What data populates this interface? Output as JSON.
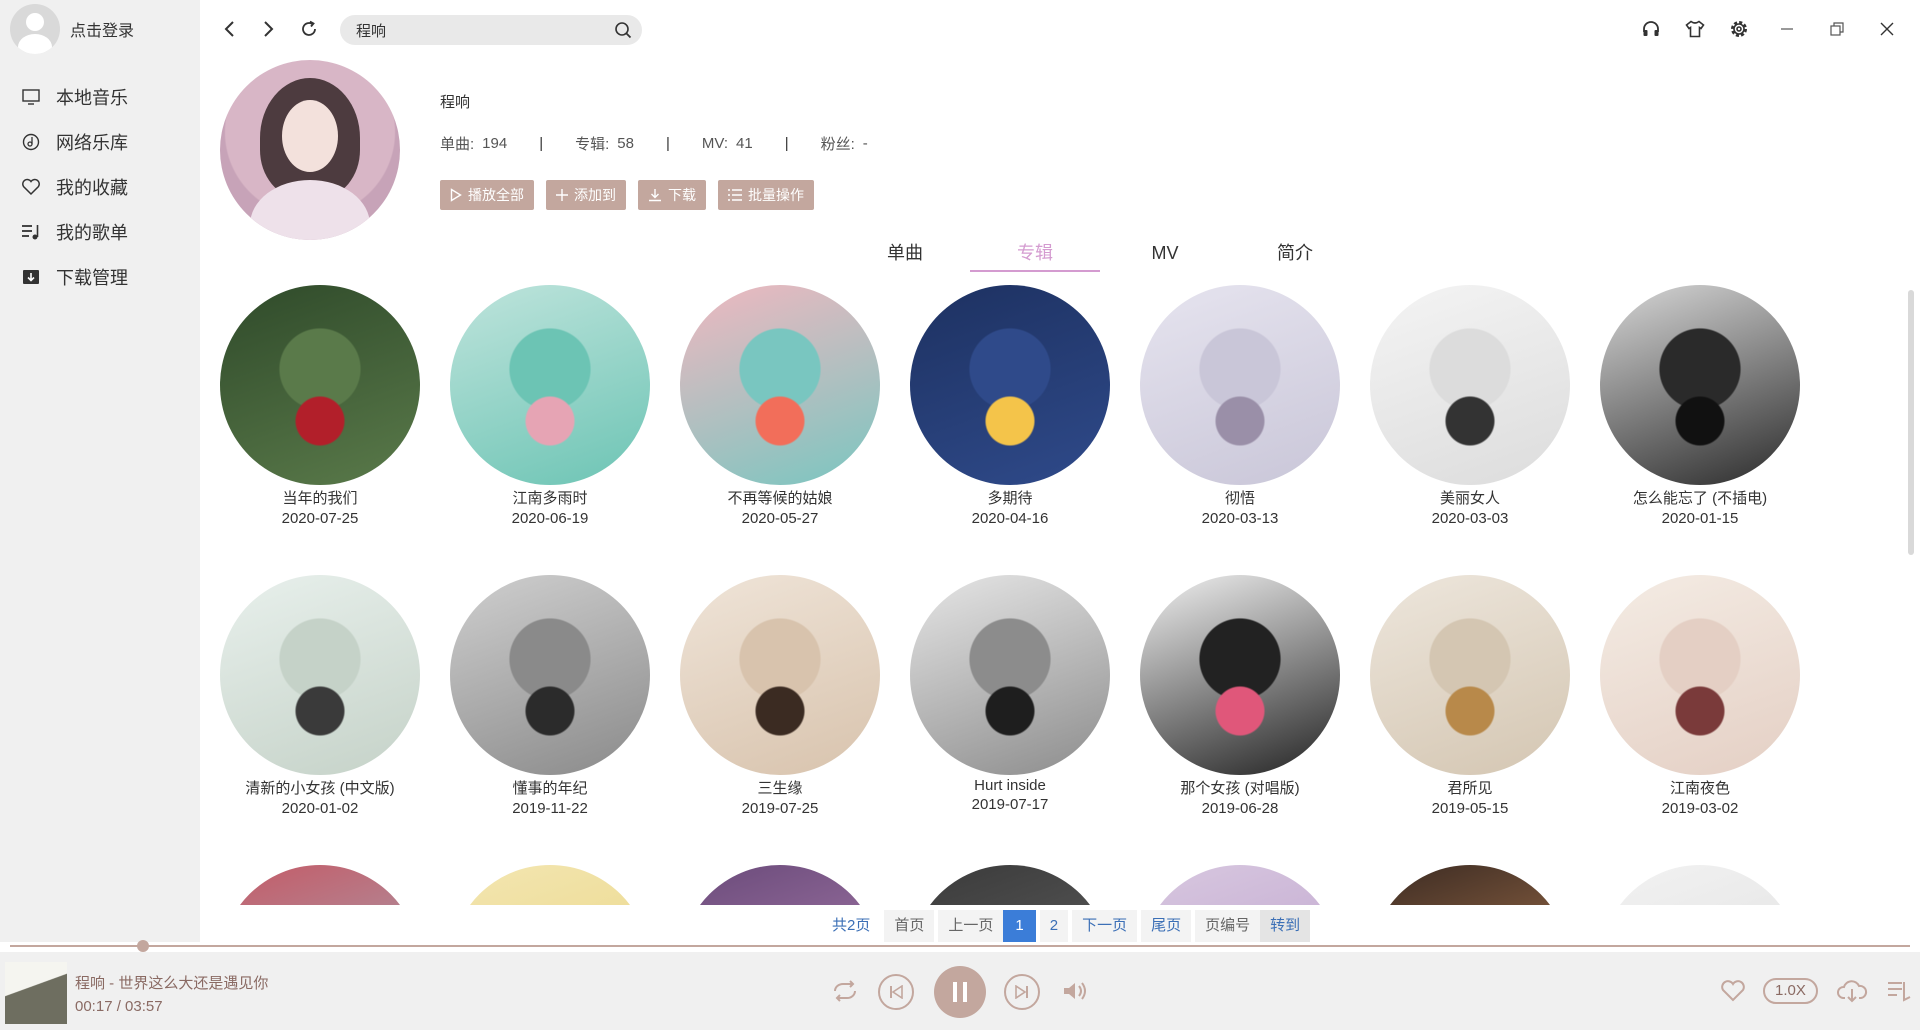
{
  "sidebar": {
    "login_label": "点击登录",
    "items": [
      {
        "label": "本地音乐",
        "icon": "monitor-icon"
      },
      {
        "label": "网络乐库",
        "icon": "music-disc-icon"
      },
      {
        "label": "我的收藏",
        "icon": "heart-icon"
      },
      {
        "label": "我的歌单",
        "icon": "playlist-icon"
      },
      {
        "label": "下载管理",
        "icon": "download-folder-icon"
      }
    ]
  },
  "search": {
    "value": "程响"
  },
  "artist": {
    "name": "程响",
    "stats": [
      {
        "label": "单曲:",
        "value": "194"
      },
      {
        "label": "专辑:",
        "value": "58"
      },
      {
        "label": "MV:",
        "value": "41"
      },
      {
        "label": "粉丝:",
        "value": "-"
      }
    ]
  },
  "actions": [
    {
      "label": "播放全部",
      "icon": "play-icon"
    },
    {
      "label": "添加到",
      "icon": "plus-icon"
    },
    {
      "label": "下载",
      "icon": "download-icon"
    },
    {
      "label": "批量操作",
      "icon": "list-icon"
    }
  ],
  "tabs": [
    {
      "label": "单曲",
      "active": false
    },
    {
      "label": "专辑",
      "active": true
    },
    {
      "label": "MV",
      "active": false
    },
    {
      "label": "简介",
      "active": false
    }
  ],
  "albums": [
    {
      "title": "当年的我们",
      "date": "2020-07-25",
      "colors": [
        "#2f4a2a",
        "#5a7a4a",
        "#b21f2a"
      ]
    },
    {
      "title": "江南多雨时",
      "date": "2020-06-19",
      "colors": [
        "#bfe4dc",
        "#6cc4b4",
        "#e6a4b4"
      ]
    },
    {
      "title": "不再等候的姑娘",
      "date": "2020-05-27",
      "colors": [
        "#f0b8c0",
        "#79c6c0",
        "#f26e5a"
      ]
    },
    {
      "title": "多期待",
      "date": "2020-04-16",
      "colors": [
        "#1d3161",
        "#2f4a8a",
        "#f4c44a"
      ]
    },
    {
      "title": "彻悟",
      "date": "2020-03-13",
      "colors": [
        "#e6e4ef",
        "#c9c6d8",
        "#9a8fa8"
      ]
    },
    {
      "title": "美丽女人",
      "date": "2020-03-03",
      "colors": [
        "#f4f4f4",
        "#dcdcdc",
        "#333333"
      ]
    },
    {
      "title": "怎么能忘了 (不插电)",
      "date": "2020-01-15",
      "colors": [
        "#d8d8d8",
        "#2a2a2a",
        "#111111"
      ]
    },
    {
      "title": "清新的小女孩 (中文版)",
      "date": "2020-01-02",
      "colors": [
        "#e8f0ec",
        "#c5d2c8",
        "#3a3a3a"
      ]
    },
    {
      "title": "懂事的年纪",
      "date": "2019-11-22",
      "colors": [
        "#cfcfcf",
        "#8a8a8a",
        "#2b2b2b"
      ]
    },
    {
      "title": "三生缘",
      "date": "2019-07-25",
      "colors": [
        "#efe4d8",
        "#d8c3ad",
        "#3b2b22"
      ]
    },
    {
      "title": "Hurt inside",
      "date": "2019-07-17",
      "colors": [
        "#e6e6e6",
        "#8c8c8c",
        "#1e1e1e"
      ]
    },
    {
      "title": "那个女孩 (对唱版)",
      "date": "2019-06-28",
      "colors": [
        "#f2f2f2",
        "#222222",
        "#e0577a"
      ]
    },
    {
      "title": "君所见",
      "date": "2019-05-15",
      "colors": [
        "#ede6dc",
        "#d4c6b2",
        "#b8894a"
      ]
    },
    {
      "title": "江南夜色",
      "date": "2019-03-02",
      "colors": [
        "#f4ece4",
        "#e4cfc4",
        "#7a3a3a"
      ]
    },
    {
      "title": "",
      "date": "",
      "colors": [
        "#c45a66",
        "#9fb8c8",
        "#6fa8b8"
      ]
    },
    {
      "title": "",
      "date": "",
      "colors": [
        "#f3e6b2",
        "#e8d27a",
        "#c8a84a"
      ]
    },
    {
      "title": "",
      "date": "",
      "colors": [
        "#6a4a7a",
        "#b88ab8",
        "#d8c8e8"
      ]
    },
    {
      "title": "",
      "date": "",
      "colors": [
        "#3a3a3a",
        "#6a6a6a",
        "#bdbdbd"
      ]
    },
    {
      "title": "",
      "date": "",
      "colors": [
        "#d8c8e0",
        "#b89ac8",
        "#f0e0f0"
      ]
    },
    {
      "title": "",
      "date": "",
      "colors": [
        "#3a2a22",
        "#c88a5a",
        "#f4d8b8"
      ]
    },
    {
      "title": "",
      "date": "",
      "colors": [
        "#f2f2f2",
        "#dcdcdc",
        "#3a3a3a"
      ]
    }
  ],
  "pager": {
    "total": "共2页",
    "first": "首页",
    "prev": "上一页",
    "pages": [
      "1",
      "2"
    ],
    "current": "1",
    "next": "下一页",
    "last": "尾页",
    "page_no": "页编号",
    "go": "转到"
  },
  "player": {
    "now_playing": "程响 - 世界这么大还是遇见你",
    "time": "00:17 / 03:57",
    "progress": 0.07,
    "speed": "1.0X"
  },
  "colors": {
    "accent": "#c3a79e",
    "tab_active": "#d49bd0",
    "pager_blue": "#3b7dd8"
  }
}
